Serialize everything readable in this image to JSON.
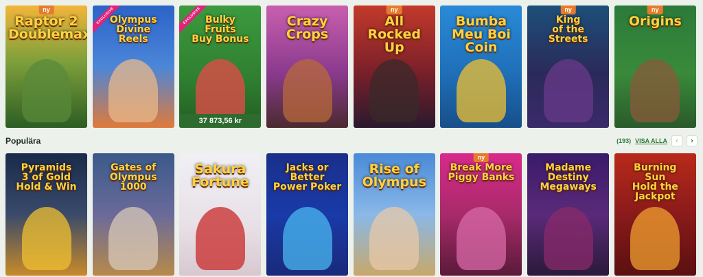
{
  "row1": [
    {
      "title": "Raptor 2\nDoublemax",
      "badge": "ny",
      "bg": "linear-gradient(180deg,#f3b53a 0%,#7fa03b 45%,#2c5d23 100%)"
    },
    {
      "title": "Olympus\nDivine\nReels",
      "badge": "exclusive",
      "bg": "linear-gradient(180deg,#2b63c8 0%,#4c86d8 50%,#e07a3a 100%)"
    },
    {
      "title": "Bulky\nFruits\nBuy Bonus",
      "badge": "exclusive",
      "jackpot": "37 873,56 kr",
      "bg": "linear-gradient(180deg,#3c9a3e 0%,#2f7f30 60%,#225e22 100%)"
    },
    {
      "title": "Crazy\nCrops",
      "bg": "linear-gradient(180deg,#c95fae 0%,#8a3a8e 55%,#4b2a2f 100%)"
    },
    {
      "title": "All\nRocked Up",
      "badge": "ny",
      "bg": "linear-gradient(180deg,#c23a2a 0%,#7a1f2a 55%,#2a1a2e 100%)"
    },
    {
      "title": "Bumba\nMeu Boi\nCoin",
      "bg": "linear-gradient(180deg,#2a8ad8 0%,#1f6fb8 55%,#184f8a 100%)"
    },
    {
      "title": "King\nof the\nStreets",
      "badge": "ny",
      "bg": "linear-gradient(180deg,#1d4f7a 0%,#2a2a5a 55%,#3a2a6a 100%)"
    },
    {
      "title": "Origins",
      "badge": "ny",
      "bg": "linear-gradient(180deg,#2b7a3a 0%,#3a8a3a 55%,#2a5a2a 100%)"
    }
  ],
  "section": {
    "title": "Populära",
    "count": "(193)",
    "see_all": "VISA ALLA",
    "prev": "‹",
    "next": "›"
  },
  "row2": [
    {
      "title": "Pyramids\n3 of Gold\nHold & Win",
      "bg": "linear-gradient(180deg,#1a2a4a 0%,#3a4a6a 50%,#c88a2a 100%)"
    },
    {
      "title": "Gates of Olympus\n1000",
      "bg": "linear-gradient(180deg,#3a5a8a 0%,#6a6a9a 50%,#b88a4a 100%)"
    },
    {
      "title": "Sakura\nFortune",
      "bg": "linear-gradient(180deg,#f0f0f5 0%,#e8e0e6 60%,#d8c8d0 100%)"
    },
    {
      "title": "Jacks or Better\nPower Poker",
      "bg": "linear-gradient(180deg,#1a2f8a 0%,#1a3aa8 50%,#1a2a7a 100%)"
    },
    {
      "title": "Rise of\nOlympus",
      "bg": "linear-gradient(180deg,#4a8ad8 0%,#8ab8e8 50%,#c8a86a 100%)"
    },
    {
      "title": "Break More\nPiggy Banks",
      "badge": "ny",
      "bg": "linear-gradient(180deg,#d82a8a 0%,#a82a6a 50%,#5a1a3a 100%)"
    },
    {
      "title": "Madame\nDestiny\nMegaways",
      "bg": "linear-gradient(180deg,#3a1a6a 0%,#5a2a7a 50%,#2a1a3a 100%)"
    },
    {
      "title": "Burning\nSun\nHold the Jackpot",
      "bg": "linear-gradient(180deg,#b82a1a 0%,#8a1a1a 50%,#5a1010 100%)"
    }
  ],
  "colors": {
    "bg": "#edf1ec",
    "accent": "#2d7a3a",
    "ny_badge": "#e87b2b"
  }
}
